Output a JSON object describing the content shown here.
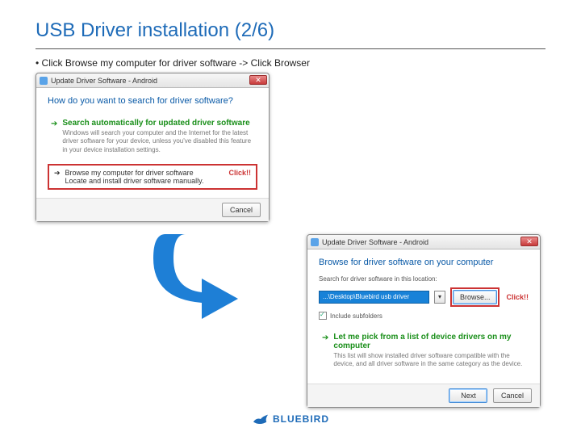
{
  "slide": {
    "title": "USB Driver installation (2/6)",
    "bullet": "Click Browse my computer for driver software -> Click Browser"
  },
  "dialog1": {
    "title": "Update Driver Software - Android",
    "heading": "How do you want to search for driver software?",
    "opt1": {
      "title": "Search automatically for updated driver software",
      "desc": "Windows will search your computer and the Internet for the latest driver software for your device, unless you've disabled this feature in your device installation settings."
    },
    "opt2": {
      "title": "Browse my computer for driver software",
      "desc": "Locate and install driver software manually."
    },
    "click_label": "Click!!",
    "cancel": "Cancel"
  },
  "dialog2": {
    "title": "Update Driver Software - Android",
    "heading": "Browse for driver software on your computer",
    "search_label": "Search for driver software in this location:",
    "path": "...\\Desktop\\Bluebird usb driver",
    "browse": "Browse...",
    "click_label": "Click!!",
    "include_sub": "Include subfolders",
    "opt": {
      "title": "Let me pick from a list of device drivers on my computer",
      "desc": "This list will show installed driver software compatible with the device, and all driver software in the same category as the device."
    },
    "next": "Next",
    "cancel": "Cancel"
  },
  "footer": {
    "brand": "BLUEBIRD"
  }
}
